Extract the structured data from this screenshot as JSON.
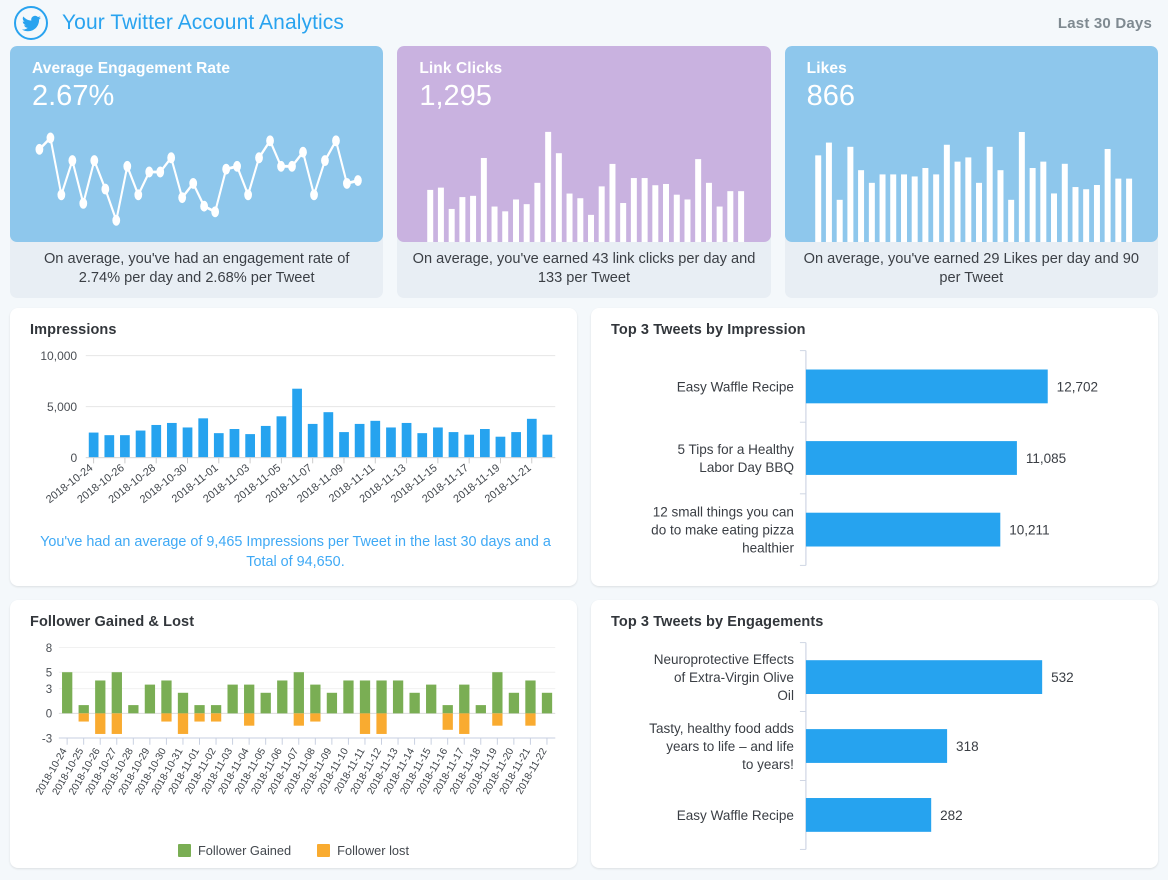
{
  "header": {
    "logo_icon": "twitter-bird-icon",
    "title": "Your Twitter Account Analytics",
    "date_range": "Last 30 Days",
    "brand_color": "#29a3ef"
  },
  "kpi_cards": [
    {
      "label": "Average Engagement Rate",
      "value": "2.67%",
      "footnote": "On average, you've had an engagement rate of 2.74% per day and 2.68% per Tweet",
      "accent": "#8ec7ec",
      "spark_type": "line"
    },
    {
      "label": "Link Clicks",
      "value": "1,295",
      "footnote": "On average, you've earned 43 link clicks per day and 133 per Tweet",
      "accent": "#c9b2e0",
      "spark_type": "bar"
    },
    {
      "label": "Likes",
      "value": "866",
      "footnote": "On average, you've earned 29 Likes per day and 90 per Tweet",
      "accent": "#8ec7ec",
      "spark_type": "bar"
    }
  ],
  "panels": {
    "impressions_title": "Impressions",
    "impressions_note": "You've had an average of 9,465 Impressions per Tweet in the last 30 days and a Total of 94,650.",
    "follower_title": "Follower Gained & Lost",
    "top_impressions_title": "Top 3 Tweets by Impression",
    "top_engagements_title": "Top 3 Tweets by Engagements"
  },
  "legend": {
    "gained_label": "Follower Gained",
    "gained_color": "#7aae54",
    "lost_label": "Follower lost",
    "lost_color": "#f9ab30"
  },
  "chart_data": [
    {
      "id": "engagement_rate_sparkline",
      "type": "line",
      "title": "Average Engagement Rate",
      "xlabel": "",
      "ylabel": "",
      "grid": false,
      "legend": "none",
      "line_color": "#ffffff",
      "marker_color": "#ffffff",
      "x": [
        "2018-10-24",
        "2018-10-25",
        "2018-10-26",
        "2018-10-27",
        "2018-10-28",
        "2018-10-29",
        "2018-10-30",
        "2018-10-31",
        "2018-11-01",
        "2018-11-02",
        "2018-11-03",
        "2018-11-04",
        "2018-11-05",
        "2018-11-06",
        "2018-11-07",
        "2018-11-08",
        "2018-11-09",
        "2018-11-10",
        "2018-11-11",
        "2018-11-12",
        "2018-11-13",
        "2018-11-14",
        "2018-11-15",
        "2018-11-16",
        "2018-11-17",
        "2018-11-18",
        "2018-11-19",
        "2018-11-20",
        "2018-11-21",
        "2018-11-22"
      ],
      "values": [
        3.05,
        3.25,
        2.25,
        2.85,
        2.1,
        2.85,
        2.35,
        1.8,
        2.75,
        2.25,
        2.65,
        2.65,
        2.9,
        2.2,
        2.45,
        2.05,
        1.95,
        2.7,
        2.75,
        2.25,
        2.9,
        3.2,
        2.75,
        2.75,
        3.0,
        2.25,
        2.85,
        3.2,
        2.45,
        2.5
      ],
      "ylim": [
        1.6,
        3.4
      ]
    },
    {
      "id": "link_clicks_sparkline",
      "type": "bar",
      "title": "Link Clicks",
      "xlabel": "",
      "ylabel": "",
      "grid": false,
      "legend": "none",
      "bar_color": "#ffffff",
      "categories": [
        "2018-10-24",
        "2018-10-25",
        "2018-10-26",
        "2018-10-27",
        "2018-10-28",
        "2018-10-29",
        "2018-10-30",
        "2018-10-31",
        "2018-11-01",
        "2018-11-02",
        "2018-11-03",
        "2018-11-04",
        "2018-11-05",
        "2018-11-06",
        "2018-11-07",
        "2018-11-08",
        "2018-11-09",
        "2018-11-10",
        "2018-11-11",
        "2018-11-12",
        "2018-11-13",
        "2018-11-14",
        "2018-11-15",
        "2018-11-16",
        "2018-11-17",
        "2018-11-18",
        "2018-11-19",
        "2018-11-20",
        "2018-11-21",
        "2018-11-22"
      ],
      "values": [
        44,
        46,
        28,
        38,
        39,
        71,
        30,
        26,
        36,
        32,
        50,
        93,
        75,
        41,
        37,
        23,
        47,
        66,
        33,
        54,
        54,
        48,
        49,
        40,
        36,
        70,
        50,
        30,
        43,
        43
      ],
      "ylim": [
        0,
        100
      ]
    },
    {
      "id": "likes_sparkline",
      "type": "bar",
      "title": "Likes",
      "xlabel": "",
      "ylabel": "",
      "grid": false,
      "legend": "none",
      "bar_color": "#ffffff",
      "categories": [
        "2018-10-24",
        "2018-10-25",
        "2018-10-26",
        "2018-10-27",
        "2018-10-28",
        "2018-10-29",
        "2018-10-30",
        "2018-10-31",
        "2018-11-01",
        "2018-11-02",
        "2018-11-03",
        "2018-11-04",
        "2018-11-05",
        "2018-11-06",
        "2018-11-07",
        "2018-11-08",
        "2018-11-09",
        "2018-11-10",
        "2018-11-11",
        "2018-11-12",
        "2018-11-13",
        "2018-11-14",
        "2018-11-15",
        "2018-11-16",
        "2018-11-17",
        "2018-11-18",
        "2018-11-19",
        "2018-11-20",
        "2018-11-21",
        "2018-11-22"
      ],
      "values": [
        41,
        47,
        20,
        45,
        34,
        28,
        32,
        32,
        32,
        31,
        35,
        32,
        46,
        38,
        40,
        28,
        45,
        34,
        20,
        52,
        35,
        38,
        23,
        37,
        26,
        25,
        27,
        44,
        30,
        30
      ],
      "ylim": [
        0,
        56
      ]
    },
    {
      "id": "impressions",
      "type": "bar",
      "title": "Impressions",
      "xlabel": "",
      "ylabel": "",
      "grid": true,
      "legend": "none",
      "bar_color": "#26a3ef",
      "ylim": [
        0,
        10000
      ],
      "yticks": [
        0,
        5000,
        10000
      ],
      "ytick_labels": [
        "0",
        "5,000",
        "10,000"
      ],
      "categories": [
        "2018-10-24",
        "2018-10-25",
        "2018-10-26",
        "2018-10-27",
        "2018-10-28",
        "2018-10-29",
        "2018-10-30",
        "2018-10-31",
        "2018-11-01",
        "2018-11-02",
        "2018-11-03",
        "2018-11-04",
        "2018-11-05",
        "2018-11-06",
        "2018-11-07",
        "2018-11-08",
        "2018-11-09",
        "2018-11-10",
        "2018-11-11",
        "2018-11-12",
        "2018-11-13",
        "2018-11-14",
        "2018-11-15",
        "2018-11-16",
        "2018-11-17",
        "2018-11-18",
        "2018-11-19",
        "2018-11-20",
        "2018-11-21",
        "2018-11-22"
      ],
      "xtick_labels": [
        "2018-10-24",
        "2018-10-26",
        "2018-10-28",
        "2018-10-30",
        "2018-11-01",
        "2018-11-03",
        "2018-11-05",
        "2018-11-07",
        "2018-11-09",
        "2018-11-11",
        "2018-11-13",
        "2018-11-15",
        "2018-11-17",
        "2018-11-19",
        "2018-11-21"
      ],
      "values": [
        2450,
        2200,
        2200,
        2650,
        3200,
        3400,
        2950,
        3850,
        2400,
        2800,
        2300,
        3100,
        4050,
        6750,
        3300,
        4450,
        2500,
        3300,
        3600,
        2950,
        3400,
        2400,
        2950,
        2500,
        2250,
        2800,
        2050,
        2500,
        3800,
        2250
      ]
    },
    {
      "id": "follower_gained_lost",
      "type": "bar",
      "title": "Follower Gained & Lost",
      "xlabel": "",
      "ylabel": "",
      "grid": true,
      "legend": "bottom",
      "stacked": true,
      "ylim": [
        -3,
        8
      ],
      "yticks": [
        -3,
        0,
        3,
        5,
        8
      ],
      "ytick_labels": [
        "-3",
        "0",
        "3",
        "5",
        "8"
      ],
      "categories": [
        "2018-10-24",
        "2018-10-25",
        "2018-10-26",
        "2018-10-27",
        "2018-10-28",
        "2018-10-29",
        "2018-10-30",
        "2018-10-31",
        "2018-11-01",
        "2018-11-02",
        "2018-11-03",
        "2018-11-04",
        "2018-11-05",
        "2018-11-06",
        "2018-11-07",
        "2018-11-08",
        "2018-11-09",
        "2018-11-10",
        "2018-11-11",
        "2018-11-12",
        "2018-11-13",
        "2018-11-14",
        "2018-11-15",
        "2018-11-16",
        "2018-11-17",
        "2018-11-18",
        "2018-11-19",
        "2018-11-20",
        "2018-11-21",
        "2018-11-22"
      ],
      "series": [
        {
          "name": "Follower Gained",
          "color": "#7aae54",
          "values": [
            5,
            1,
            4,
            5,
            1,
            3.5,
            4,
            2.5,
            1,
            1,
            3.5,
            3.5,
            2.5,
            4,
            5,
            3.5,
            2.5,
            4,
            4,
            4,
            4,
            2.5,
            3.5,
            1,
            3.5,
            1,
            5,
            2.5,
            4,
            2.5
          ]
        },
        {
          "name": "Follower lost",
          "color": "#f9ab30",
          "values": [
            0,
            -1,
            -2.5,
            -2.5,
            0,
            0,
            -1,
            -2.5,
            -1,
            -1,
            0,
            -1.5,
            0,
            0,
            -1.5,
            -1,
            0,
            0,
            -2.5,
            -2.5,
            0,
            0,
            0,
            -2,
            -2.5,
            0,
            -1.5,
            0,
            -1.5,
            0
          ]
        }
      ]
    },
    {
      "id": "top_tweets_by_impression",
      "type": "bar",
      "orientation": "horizontal",
      "title": "Top 3 Tweets by Impression",
      "xlabel": "",
      "ylabel": "",
      "grid": false,
      "legend": "none",
      "bar_color": "#26a3ef",
      "categories": [
        "Easy Waffle Recipe",
        "5 Tips for a Healthy Labor Day BBQ",
        "12 small things you can do to make eating pizza healthier"
      ],
      "values": [
        12702,
        11085,
        10211
      ],
      "value_labels": [
        "12,702",
        "11,085",
        "10,211"
      ],
      "xlim": [
        0,
        14000
      ]
    },
    {
      "id": "top_tweets_by_engagements",
      "type": "bar",
      "orientation": "horizontal",
      "title": "Top 3 Tweets by Engagements",
      "xlabel": "",
      "ylabel": "",
      "grid": false,
      "legend": "none",
      "bar_color": "#26a3ef",
      "categories": [
        "Neuroprotective Effects of Extra-Virgin Olive Oil",
        "Tasty, healthy food adds years to life – and life to years!",
        "Easy Waffle Recipe"
      ],
      "values": [
        532,
        318,
        282
      ],
      "value_labels": [
        "532",
        "318",
        "282"
      ],
      "xlim": [
        0,
        600
      ]
    }
  ]
}
